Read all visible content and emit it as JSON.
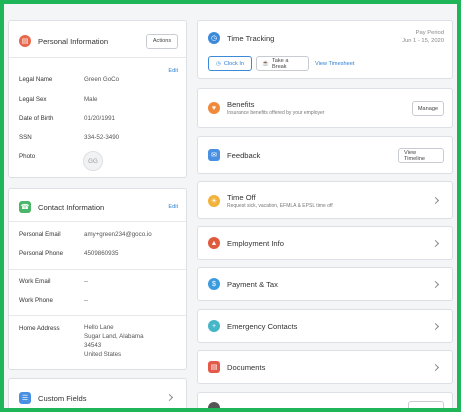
{
  "personal": {
    "title": "Personal Information",
    "actions_label": "Actions",
    "edit_label": "Edit",
    "fields": [
      {
        "label": "Legal Name",
        "value": "Green GoCo"
      },
      {
        "label": "Legal Sex",
        "value": "Male"
      },
      {
        "label": "Date of Birth",
        "value": "01/20/1991"
      },
      {
        "label": "SSN",
        "value": "334-52-3490"
      },
      {
        "label": "Photo",
        "value": ""
      }
    ],
    "avatar_initials": "GG"
  },
  "contact": {
    "title": "Contact Information",
    "edit_label": "Edit",
    "fields": [
      {
        "label": "Personal Email",
        "value": "amy+green234@goco.io"
      },
      {
        "label": "Personal Phone",
        "value": "4509860935"
      },
      {
        "label": "Work Email",
        "value": "--"
      },
      {
        "label": "Work Phone",
        "value": "--"
      },
      {
        "label": "Home Address",
        "value": "Hello Lane"
      }
    ],
    "address_lines": [
      "Hello Lane",
      "Sugar Land, Alabama",
      "34543",
      "United States"
    ]
  },
  "custom_fields": {
    "title": "Custom Fields"
  },
  "time_tracking": {
    "title": "Time Tracking",
    "pay_period_label": "Pay Period",
    "pay_period_value": "Jun 1 - 15, 2020",
    "clock_in_label": "Clock In",
    "break_label": "Take a Break",
    "timesheet_label": "View Timesheet"
  },
  "benefits": {
    "title": "Benefits",
    "subtitle": "Insurance benefits offered by your employer",
    "manage_label": "Manage"
  },
  "feedback": {
    "title": "Feedback",
    "timeline_label": "View Timeline"
  },
  "time_off": {
    "title": "Time Off",
    "subtitle": "Request sick, vacation, EFMLA & EPSL time off"
  },
  "nav_cards": [
    {
      "title": "Employment Info"
    },
    {
      "title": "Payment & Tax"
    },
    {
      "title": "Emergency Contacts"
    },
    {
      "title": "Documents"
    }
  ],
  "colors": {
    "frame_green": "#1fb65a",
    "link_blue": "#2e7fd1",
    "personal_icon": "#e8664a",
    "contact_icon": "#49b66a",
    "tracking_icon": "#3b8ad9",
    "benefits_icon": "#f08a3a",
    "feedback_icon": "#4a90e2",
    "employment_icon": "#e05a3c",
    "payment_icon": "#3b9be0",
    "emergency_icon": "#45b5c8",
    "documents_icon": "#e45a4a"
  }
}
